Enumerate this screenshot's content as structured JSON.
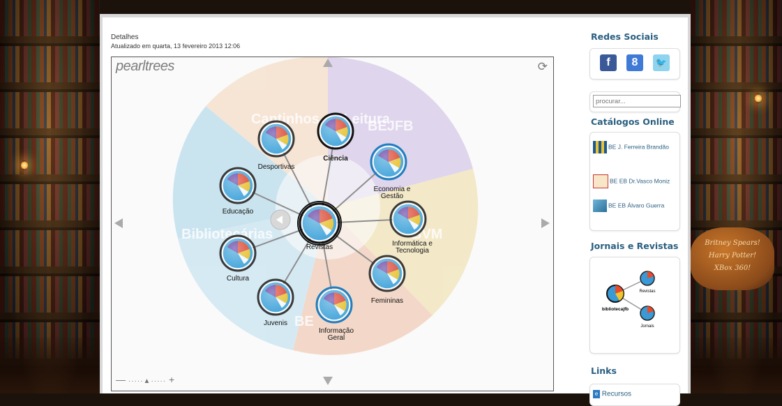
{
  "article": {
    "title": "Detalhes",
    "updated": "Atualizado em quarta, 13 fevereiro 2013 12:06"
  },
  "pearltrees": {
    "logo": "pearltrees",
    "center": "Revistas",
    "sectors": [
      "Cantinhos de Leitura",
      "BEJFB",
      "BVM",
      "BE",
      "Bibliotecárias"
    ],
    "nodes": [
      {
        "label": "Desportivas"
      },
      {
        "label": "Ciência"
      },
      {
        "label": "Economia e Gestão"
      },
      {
        "label": "Educação"
      },
      {
        "label": "Informática e Tecnologia"
      },
      {
        "label": "Cultura"
      },
      {
        "label": "Femininas"
      },
      {
        "label": "Juvenis"
      },
      {
        "label": "Informação Geral"
      }
    ],
    "icons": {
      "up": "triangle-up-icon",
      "down": "triangle-down-icon",
      "left": "triangle-left-icon",
      "right": "triangle-right-icon",
      "refresh": "refresh-icon",
      "back": "back-arrow-icon",
      "zoom_out": "minus-icon",
      "zoom_in": "plus-icon"
    }
  },
  "sidebar": {
    "social_heading": "Redes Sociais",
    "social": [
      {
        "name": "facebook-icon",
        "glyph": "f",
        "color": "#3b5998"
      },
      {
        "name": "google-icon",
        "glyph": "8",
        "color": "#3f7ad6"
      },
      {
        "name": "twitter-icon",
        "glyph": "🐦",
        "color": "#5bb8e0"
      }
    ],
    "search_placeholder": "procurar...",
    "catalogs_heading": "Catálogos Online",
    "catalogs": [
      {
        "label": "BE J. Ferreira Brandão"
      },
      {
        "label": "BE EB Dr.Vasco Moniz"
      },
      {
        "label": "BE EB Álvaro Guerra"
      }
    ],
    "jornais_heading": "Jornais e Revistas",
    "mini_tree": {
      "root": "bibliotecajfb",
      "a": "Revistas",
      "b": "Jornais"
    },
    "links_heading": "Links",
    "links": [
      {
        "label": "Recursos"
      }
    ]
  },
  "background": {
    "sign_lines": [
      "Britney Spears!",
      "Harry Potter!",
      "XBox 360!"
    ]
  },
  "colors": {
    "heading": "#2a5f80",
    "link": "#2b5f82",
    "pearl_blue": "#3a9ad6"
  }
}
